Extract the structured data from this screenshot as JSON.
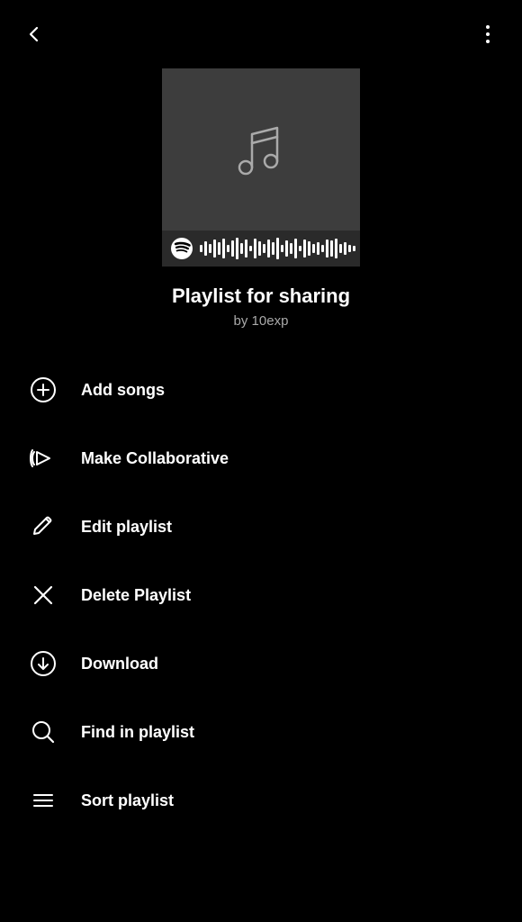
{
  "header": {
    "back_label": "Back",
    "more_label": "More options"
  },
  "playlist": {
    "title": "Playlist for sharing",
    "author": "by 10exp"
  },
  "menu_items": [
    {
      "id": "add-songs",
      "label": "Add songs",
      "icon": "plus-circle-icon"
    },
    {
      "id": "make-collaborative",
      "label": "Make Collaborative",
      "icon": "collaborative-icon"
    },
    {
      "id": "edit-playlist",
      "label": "Edit playlist",
      "icon": "edit-icon"
    },
    {
      "id": "delete-playlist",
      "label": "Delete Playlist",
      "icon": "delete-icon"
    },
    {
      "id": "download",
      "label": "Download",
      "icon": "download-icon"
    },
    {
      "id": "find-in-playlist",
      "label": "Find in playlist",
      "icon": "search-icon"
    },
    {
      "id": "sort-playlist",
      "label": "Sort playlist",
      "icon": "sort-icon"
    }
  ],
  "colors": {
    "background": "#000000",
    "text_primary": "#ffffff",
    "text_secondary": "#aaaaaa",
    "album_bg": "#3d3d3d",
    "spotify_bar_bg": "#2a2a2a"
  }
}
